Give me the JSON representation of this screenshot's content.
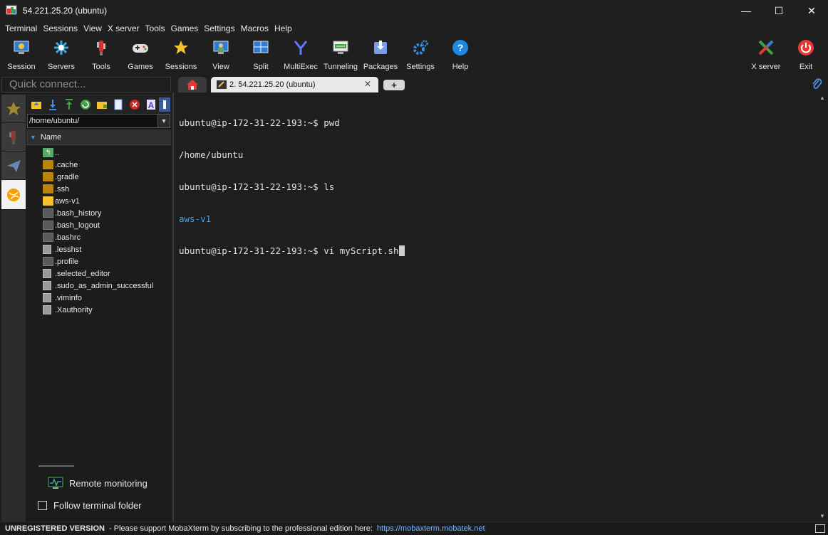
{
  "window": {
    "title": "54.221.25.20 (ubuntu)",
    "controls": {
      "minimize": "—",
      "maximize": "☐",
      "close": "✕"
    }
  },
  "menu": [
    "Terminal",
    "Sessions",
    "View",
    "X server",
    "Tools",
    "Games",
    "Settings",
    "Macros",
    "Help"
  ],
  "toolbar": {
    "session": "Session",
    "servers": "Servers",
    "tools": "Tools",
    "games": "Games",
    "sessions": "Sessions",
    "view": "View",
    "split": "Split",
    "multiexec": "MultiExec",
    "tunneling": "Tunneling",
    "packages": "Packages",
    "settings": "Settings",
    "help": "Help",
    "xserver": "X server",
    "exit": "Exit"
  },
  "quick_connect": {
    "placeholder": "Quick connect..."
  },
  "file_browser": {
    "path": "/home/ubuntu/",
    "column_header": "Name",
    "items": [
      {
        "name": "..",
        "icon": "up-folder-icon"
      },
      {
        "name": ".cache",
        "icon": "folder-icon"
      },
      {
        "name": ".gradle",
        "icon": "folder-icon"
      },
      {
        "name": ".ssh",
        "icon": "folder-icon"
      },
      {
        "name": "aws-v1",
        "icon": "folder-icon"
      },
      {
        "name": ".bash_history",
        "icon": "file-icon"
      },
      {
        "name": ".bash_logout",
        "icon": "file-icon"
      },
      {
        "name": ".bashrc",
        "icon": "file-icon"
      },
      {
        "name": ".lesshst",
        "icon": "file-icon"
      },
      {
        "name": ".profile",
        "icon": "file-icon"
      },
      {
        "name": ".selected_editor",
        "icon": "file-icon"
      },
      {
        "name": ".sudo_as_admin_successful",
        "icon": "file-icon"
      },
      {
        "name": ".viminfo",
        "icon": "file-icon"
      },
      {
        "name": ".Xauthority",
        "icon": "file-icon"
      }
    ],
    "remote_monitoring": "Remote monitoring",
    "follow_terminal_folder": "Follow terminal folder"
  },
  "tabs": {
    "session_tab_label": "2. 54.221.25.20 (ubuntu)",
    "close": "✕",
    "new_tab": "+"
  },
  "terminal": {
    "lines": [
      {
        "text": "ubuntu@ip-172-31-22-193:~$ pwd",
        "style": "normal"
      },
      {
        "text": "/home/ubuntu",
        "style": "normal"
      },
      {
        "text": "ubuntu@ip-172-31-22-193:~$ ls",
        "style": "normal"
      },
      {
        "text": "aws-v1",
        "style": "blue"
      },
      {
        "text": "ubuntu@ip-172-31-22-193:~$ vi myScript.sh",
        "style": "cursor"
      }
    ]
  },
  "statusbar": {
    "unregistered": "UNREGISTERED VERSION",
    "message": "-  Please support MobaXterm by subscribing to the professional edition here:",
    "link": "https://mobaxterm.mobatek.net"
  },
  "colors": {
    "accent_blue": "#3aa8e8",
    "exit_red": "#e53935",
    "folder_yellow": "#f4c430"
  }
}
